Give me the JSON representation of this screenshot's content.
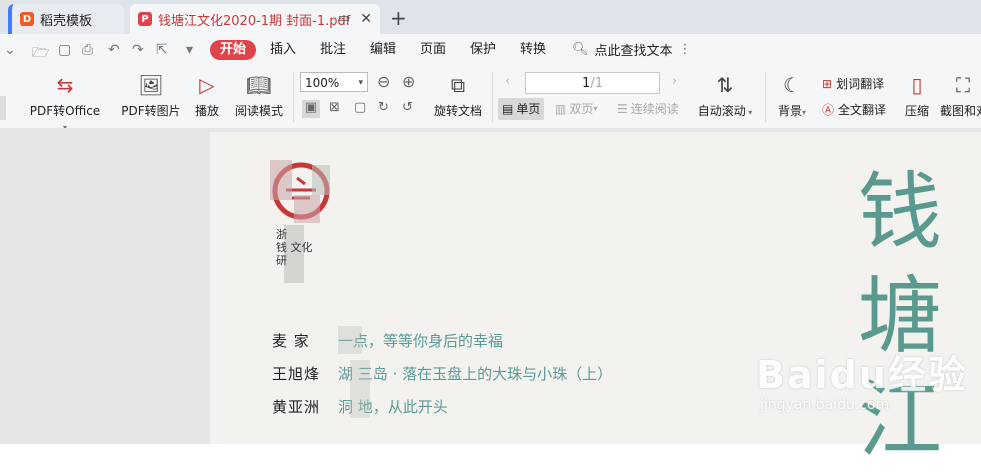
{
  "tabs": [
    {
      "label": "稻壳模板"
    },
    {
      "label": "钱塘江文化2020-1期 封面-1.pdf"
    }
  ],
  "menu": {
    "items": [
      "开始",
      "插入",
      "批注",
      "编辑",
      "页面",
      "保护",
      "转换"
    ],
    "search_label": "点此查找文本"
  },
  "toolbar": {
    "pdf_office": "PDF转Office",
    "pdf_image": "PDF转图片",
    "play": "播放",
    "read_mode": "阅读模式",
    "zoom": "100%",
    "rotate": "旋转文档",
    "page_current": "1",
    "page_total": "/1",
    "single_page": "单页",
    "double_page": "双页",
    "continuous": "连续阅读",
    "auto_scroll": "自动滚动",
    "background": "背景",
    "word_translate": "划词翻译",
    "full_translate": "全文翻译",
    "compress": "压缩",
    "screenshot": "截图和对"
  },
  "document": {
    "org_lines": [
      "浙",
      "钱   文化",
      "研"
    ],
    "articles": [
      {
        "author": "麦  家",
        "title": "一点，等等你身后的幸福"
      },
      {
        "author": "王旭烽",
        "title": "湖   三岛 · 落在玉盘上的大珠与小珠（上）"
      },
      {
        "author": "黄亚洲",
        "title": "洞   地，从此开头"
      }
    ],
    "vertical_title": [
      "钱",
      "塘",
      "江"
    ]
  },
  "watermark": {
    "brand": "Baidu经验",
    "url": "jingyan.baidu.com"
  }
}
